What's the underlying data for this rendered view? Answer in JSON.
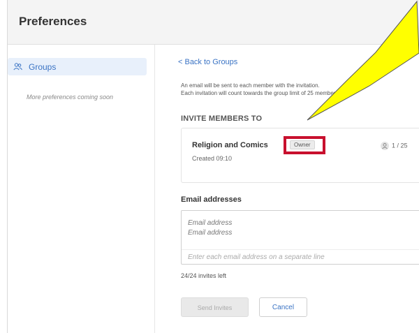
{
  "header": {
    "title": "Preferences"
  },
  "sidebar": {
    "items": [
      {
        "label": "Groups",
        "icon": "users-icon"
      }
    ],
    "note": "More preferences coming soon"
  },
  "main": {
    "back_link": "< Back to Groups",
    "notice_line1": "An email will be sent to each member with the invitation.",
    "notice_line2": "Each invitation will count towards the group limit of 25 members.",
    "section_heading": "INVITE MEMBERS TO",
    "group": {
      "name": "Religion and Comics",
      "badge": "Owner",
      "created": "Created 09:10",
      "member_count": "1 / 25"
    },
    "email": {
      "heading": "Email addresses",
      "values": [
        "Email address",
        "Email address"
      ],
      "placeholder": "Enter each email address on a separate line"
    },
    "invites_left": "24/24 invites left",
    "buttons": {
      "send": "Send Invites",
      "cancel": "Cancel"
    }
  },
  "colors": {
    "accent": "#3a73c4",
    "highlight": "#c8102e",
    "callout_fill": "#ffff00"
  }
}
